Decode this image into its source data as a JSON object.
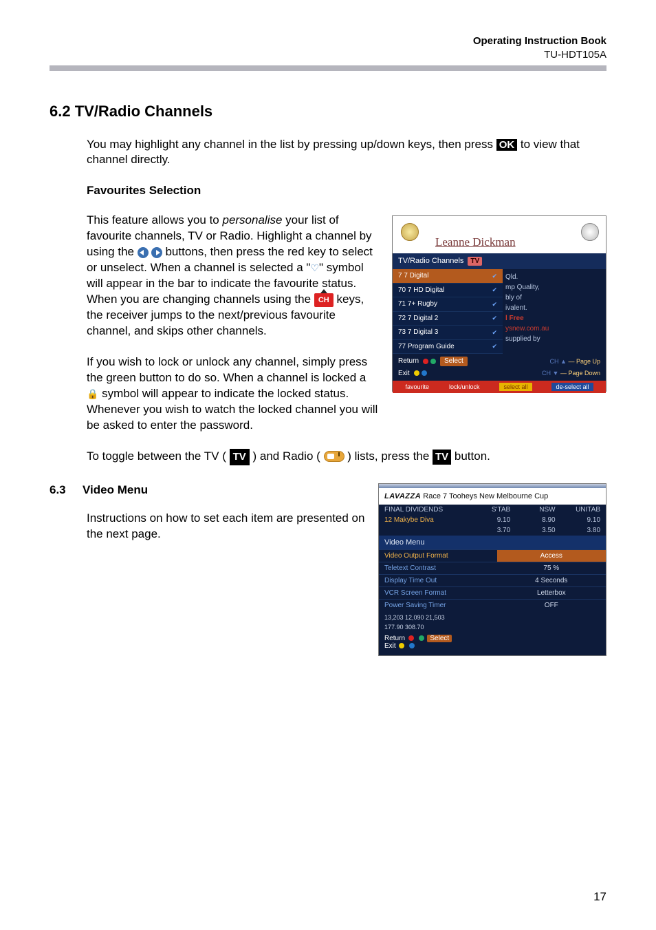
{
  "header": {
    "book": "Operating Instruction Book",
    "model": "TU-HDT105A"
  },
  "section62": {
    "heading": "6.2  TV/Radio Channels",
    "p1a": "You may highlight any channel in the list by pressing up/down keys, then press ",
    "ok": "OK",
    "p1b": " to view that channel directly.",
    "fav_heading": "Favourites Selection",
    "fa1": "This feature allows you to ",
    "fa_em": "personalise",
    "fa2": " your list of favourite channels, TV or Radio. Highlight a channel by using the ",
    "fa3": " buttons, then press the red key to select or unselect. When a channel is selected a \"",
    "fa4": "\" symbol will appear in the bar to indicate the favourite status.  When you are changing channels using the ",
    "ch": "CH",
    "fa5": "  keys, the receiver jumps to the next/previous favourite channel, and skips other channels.",
    "pb": "If you wish to lock or unlock any channel, simply press the green button to do so. When a channel is locked a ",
    "pb2": " symbol will appear to indicate the locked status.  Whenever you wish to watch the locked channel you will be asked to enter the password.",
    "toggle_a": "To toggle between the TV ( ",
    "tv": "TV",
    "toggle_b": " ) and Radio ( ",
    "toggle_c": " ) lists, press the ",
    "toggle_d": " button."
  },
  "screenshot1": {
    "name": "Leanne Dickman",
    "bar_label": "TV/Radio Channels",
    "bar_tag": "TV",
    "rows": [
      "7 7 Digital",
      "70 7 HD Digital",
      "71 7+ Rugby",
      "72 7 Digital 2",
      "73 7 Digital 3",
      "77 Program Guide"
    ],
    "right_lines": [
      "Qld.",
      "mp Quality,",
      "bly of",
      "ivalent.",
      "l Free",
      "ysnew.com.au",
      "supplied by"
    ],
    "return": "Return",
    "select": "Select",
    "pageup": "Page Up",
    "pagedown": "Page Down",
    "exit": "Exit",
    "foot": [
      "favourite",
      "lock/unlock",
      "select all",
      "de-select all"
    ]
  },
  "section63": {
    "num": "6.3",
    "title": "Video Menu",
    "para": "Instructions on how to set each item are presented on the next page."
  },
  "screenshot2": {
    "bread_logo": "LAVAZZA",
    "bread_rest": " Race 7  Tooheys New Melbourne Cup",
    "hdr": [
      "FINAL DIVIDENDS",
      "S'TAB",
      "NSW",
      "UNITAB"
    ],
    "val_name": "12  Makybe Diva",
    "vals1": [
      "9.10",
      "8.90",
      "9.10"
    ],
    "vals2": [
      "3.70",
      "3.50",
      "3.80"
    ],
    "menu_title": "Video Menu",
    "rows": [
      [
        "Video Output Format",
        "Access"
      ],
      [
        "Teletext Contrast",
        "75 %"
      ],
      [
        "Display Time Out",
        "4 Seconds"
      ],
      [
        "VCR Screen Format",
        "Letterbox"
      ],
      [
        "Power Saving Timer",
        "OFF"
      ]
    ],
    "ft_left": "13,203   12,090   21,503",
    "ft_right": "177.90   308.70",
    "return": "Return",
    "select": "Select",
    "exit": "Exit"
  },
  "page_number": "17"
}
